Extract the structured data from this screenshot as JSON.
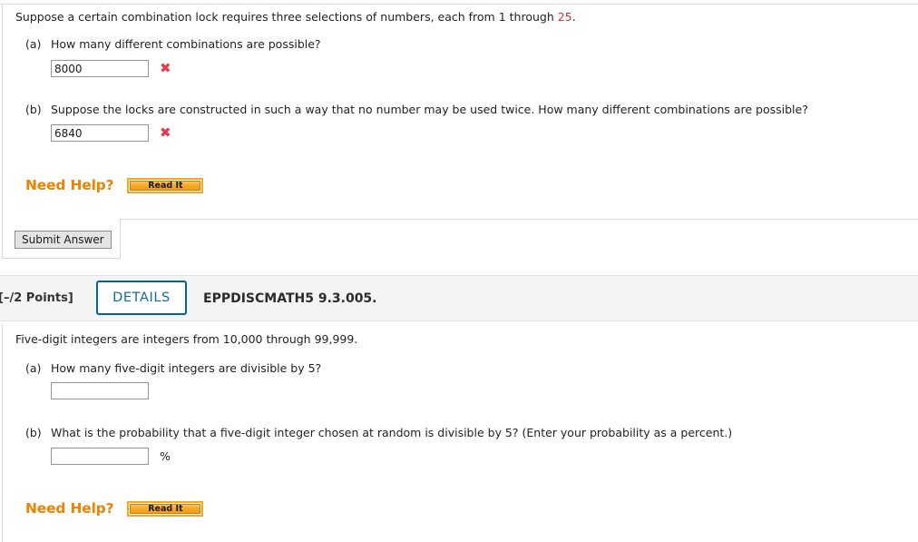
{
  "question1": {
    "stem_before": "Suppose a certain combination lock requires three selections of numbers, each from 1 through ",
    "stem_number": "25",
    "stem_after": ".",
    "parts": [
      {
        "label": "(a)",
        "text": "How many different combinations are possible?",
        "answer_value": "8000",
        "answer_placeholder": "",
        "status_icon": "✖",
        "status": "incorrect"
      },
      {
        "label": "(b)",
        "text": "Suppose the locks are constructed in such a way that no number may be used twice. How many different combinations are possible?",
        "answer_value": "6840",
        "answer_placeholder": "",
        "status_icon": "✖",
        "status": "incorrect"
      }
    ],
    "need_help_label": "Need Help?",
    "read_it_label": "Read It",
    "submit_label": "Submit Answer"
  },
  "question2": {
    "points": "[–/2 Points]",
    "details_label": "DETAILS",
    "code": "EPPDISCMATH5 9.3.005.",
    "stem": "Five-digit integers are integers from 10,000 through 99,999.",
    "parts": [
      {
        "label": "(a)",
        "text": "How many five-digit integers are divisible by 5?",
        "answer_value": "",
        "answer_placeholder": "",
        "suffix": ""
      },
      {
        "label": "(b)",
        "text": "What is the probability that a five-digit integer chosen at random is divisible by 5? (Enter your probability as a percent.)",
        "answer_value": "",
        "answer_placeholder": "",
        "suffix": "%"
      }
    ],
    "need_help_label": "Need Help?",
    "read_it_label": "Read It"
  },
  "colors": {
    "accent_orange": "#ef8200",
    "button_orange": "#f5a623",
    "details_blue": "#006298",
    "error_red": "#e8384f",
    "highlight_red": "#e03131",
    "header_gray": "#f4f4f4"
  }
}
